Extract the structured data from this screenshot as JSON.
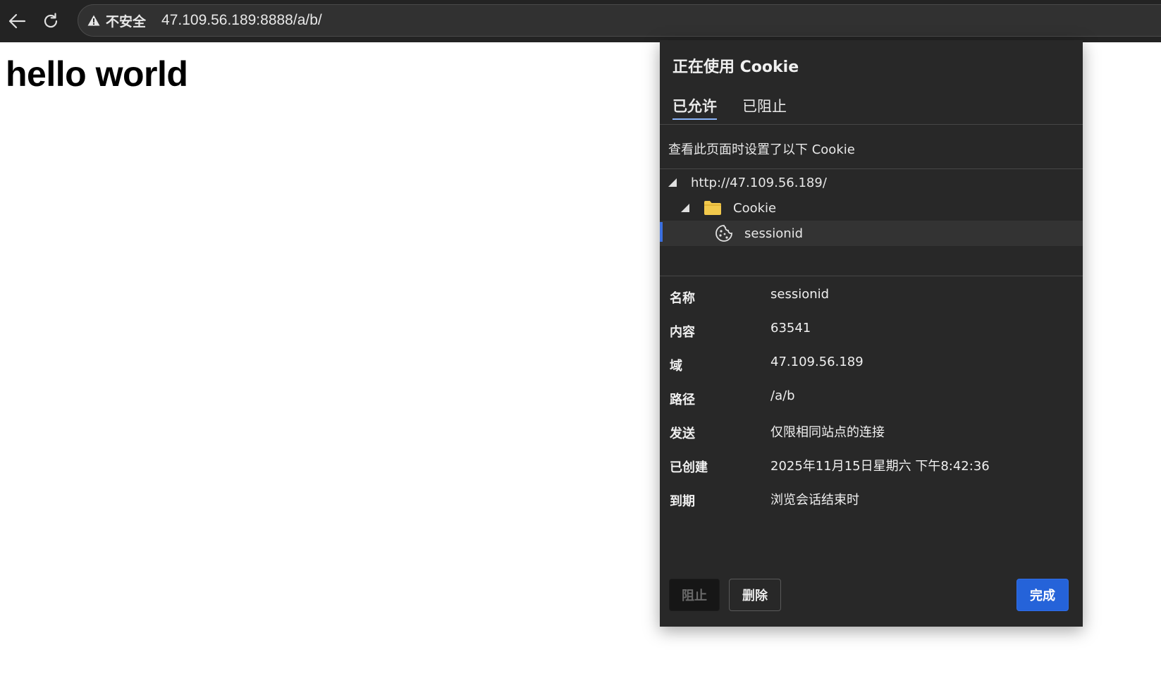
{
  "browser": {
    "security_label": "不安全",
    "url": "47.109.56.189:8888/a/b/",
    "icons": {
      "back": "back-arrow-icon",
      "reload": "reload-icon",
      "security": "warning-triangle-icon"
    }
  },
  "page": {
    "heading": "hello world"
  },
  "cookie_dialog": {
    "title": "正在使用 Cookie",
    "tabs": [
      {
        "label": "已允许",
        "active": true
      },
      {
        "label": "已阻止",
        "active": false
      }
    ],
    "description": "查看此页面时设置了以下 Cookie",
    "tree": {
      "origin": "http://47.109.56.189/",
      "folder": "Cookie",
      "cookie": "sessionid"
    },
    "details": [
      {
        "label": "名称",
        "value": "sessionid"
      },
      {
        "label": "内容",
        "value": "63541"
      },
      {
        "label": "域",
        "value": "47.109.56.189"
      },
      {
        "label": "路径",
        "value": "/a/b"
      },
      {
        "label": "发送",
        "value": "仅限相同站点的连接"
      },
      {
        "label": "已创建",
        "value": "2025年11月15日星期六 下午8:42:36"
      },
      {
        "label": "到期",
        "value": "浏览会话结束时"
      }
    ],
    "buttons": {
      "block": "阻止",
      "delete": "删除",
      "done": "完成"
    },
    "colors": {
      "accent": "#2563d9",
      "tab_underline": "#8ab4f8",
      "folder": "#f2c94c"
    }
  }
}
